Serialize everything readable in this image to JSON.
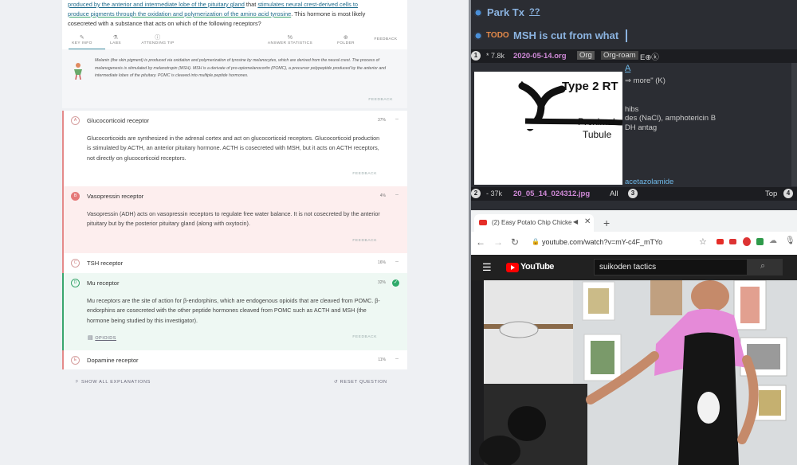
{
  "question": {
    "line1_a": "produced by the anterior and intermediate lobe of the pituitary gland",
    "line1_b": " that ",
    "line1_c": "stimulates neural crest-derived cells to",
    "line2_a": "produce pigments through the oxidation and polymerization of the amino acid tyrosine",
    "line2_b": ". This hormone is most likely",
    "line3": "cosecreted with a substance that acts on which of the following receptors?"
  },
  "toolbar": {
    "key_info": "KEY INFO",
    "labs": "LABS",
    "attending_tip": "ATTENDING TIP",
    "answer_statistics": "ANSWER STATISTICS",
    "folder": "FOLDER",
    "feedback": "FEEDBACK"
  },
  "explanation": {
    "text": "Melanin (the skin pigment) is produced via oxidation and polymerization of tyrosine by melanocytes, which are derived from the neural crest. The process of melanogenesis is stimulated by melanotropin (MSH). MSH is a derivate of pro-opiomelanocortin (POMC), a precursor polypeptide produced by the anterior and intermediate lobes of the pituitary. POMC is cleaved into multiple peptide hormones.",
    "feedback": "FEEDBACK"
  },
  "options": [
    {
      "letter": "A",
      "label": "Glucocorticoid receptor",
      "pct": "37%",
      "body": "Glucocorticoids are synthesized in the adrenal cortex and act on glucocorticoid receptors. Glucocorticoid production is stimulated by ACTH, an anterior pituitary hormone. ACTH is cosecreted with MSH, but it acts on ACTH receptors, not directly on glucocorticoid receptors.",
      "feedback": "FEEDBACK"
    },
    {
      "letter": "B",
      "label": "Vasopressin receptor",
      "pct": "4%",
      "body": "Vasopressin (ADH) acts on vasopressin receptors to regulate free water balance. It is not cosecreted by the anterior pituitary but by the posterior pituitary gland (along with oxytocin).",
      "feedback": "FEEDBACK"
    },
    {
      "letter": "C",
      "label": "TSH receptor",
      "pct": "16%"
    },
    {
      "letter": "D",
      "label": "Mu receptor",
      "pct": "32%",
      "body": "Mu receptors are the site of action for β-endorphins, which are endogenous opioids that are cleaved from POMC. β-endorphins are cosecreted with the other peptide hormones cleaved from POMC such as ACTH and MSH (the hormone being studied by this investigator).",
      "tag": "OPIOIDS",
      "feedback": "FEEDBACK"
    },
    {
      "letter": "E",
      "label": "Dopamine receptor",
      "pct": "11%"
    }
  ],
  "bottom": {
    "show_all": "SHOW ALL EXPLANATIONS",
    "reset": "RESET QUESTION"
  },
  "org": {
    "heading1": "Park Tx",
    "heading1_q": "??",
    "todo": "TODO",
    "heading2": "MSH is cut from what",
    "modeline_top": {
      "num": "1",
      "star": "*",
      "size": "7.8k",
      "file": "2020-05-14.org",
      "mode1": "Org",
      "mode2": "Org-roam",
      "extra": "E⊕ⓚ"
    },
    "image_label_1": "Type 2 RT",
    "image_label_2": "Proximal",
    "image_label_3": "Tubule",
    "text_lines": [
      "A",
      "⇒ more\" (K)",
      "",
      "",
      "hibs",
      "des (NaCl), amphotericin B",
      "DH antag",
      "",
      "",
      "",
      "",
      "",
      "acetazolamide"
    ],
    "modeline_bottom": {
      "num": "2",
      "dash": "-",
      "size": "37k",
      "file": "20_05_14_024312.jpg",
      "pos": "All",
      "num3": "3",
      "top": "Top",
      "num4": "4"
    }
  },
  "browser": {
    "tab_title": "(2) Easy Potato Chip Chicke",
    "url": "youtube.com/watch?v=mY-c4F_mTYo",
    "yt_logo": "YouTube",
    "search_value": "suikoden tactics"
  }
}
